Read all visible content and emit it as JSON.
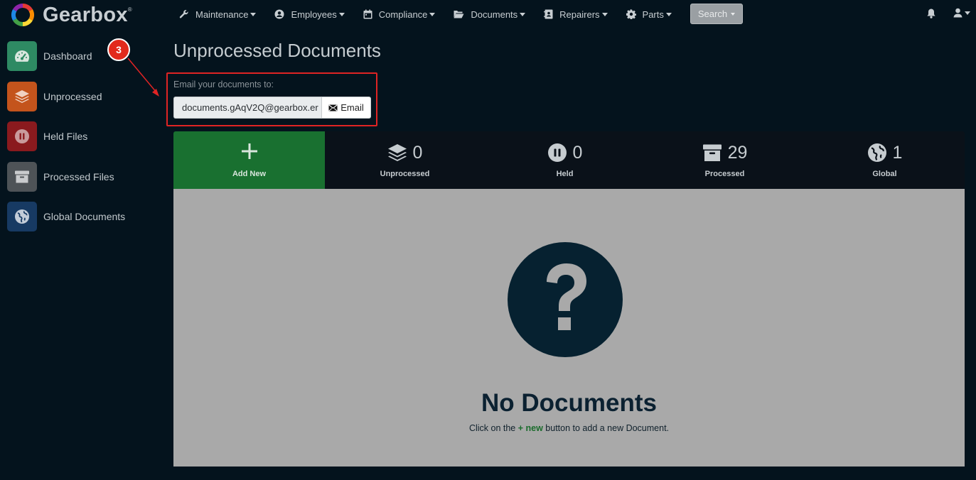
{
  "app": {
    "name": "Gearbox",
    "trademark": "®"
  },
  "nav": {
    "items": [
      {
        "label": "Maintenance",
        "icon": "wrench-icon"
      },
      {
        "label": "Employees",
        "icon": "user-circle-icon"
      },
      {
        "label": "Compliance",
        "icon": "calendar-icon"
      },
      {
        "label": "Documents",
        "icon": "folder-open-icon"
      },
      {
        "label": "Repairers",
        "icon": "contact-book-icon"
      },
      {
        "label": "Parts",
        "icon": "gear-icon"
      }
    ],
    "search_label": "Search"
  },
  "sidebar": {
    "items": [
      {
        "label": "Dashboard",
        "icon": "speedometer-icon",
        "color": "#2e8a63"
      },
      {
        "label": "Unprocessed",
        "icon": "layers-icon",
        "color": "#c4541c"
      },
      {
        "label": "Held Files",
        "icon": "pause-icon",
        "color": "#8a1a1e"
      },
      {
        "label": "Processed Files",
        "icon": "archive-icon",
        "color": "#4e5357"
      },
      {
        "label": "Global Documents",
        "icon": "globe-icon",
        "color": "#173a63"
      }
    ]
  },
  "page": {
    "title": "Unprocessed Documents"
  },
  "email": {
    "caption": "Email your documents to:",
    "address": "documents.gAqV2Q@gearbox.er",
    "button_label": "Email"
  },
  "annotation": {
    "number": "3",
    "color": "#e02424"
  },
  "stats": {
    "add_new_label": "Add New",
    "items": [
      {
        "label": "Unprocessed",
        "count": "0",
        "icon": "layers-icon"
      },
      {
        "label": "Held",
        "count": "0",
        "icon": "pause-circle-icon"
      },
      {
        "label": "Processed",
        "count": "29",
        "icon": "archive-icon"
      },
      {
        "label": "Global",
        "count": "1",
        "icon": "globe-icon"
      }
    ]
  },
  "empty_state": {
    "title": "No Documents",
    "text_before": "Click on the ",
    "new_text": "+ new",
    "text_after": " button to add a new Document."
  },
  "colors": {
    "background": "#04131d",
    "accent_green": "#197030",
    "panel_gray": "#a9a9a9"
  }
}
